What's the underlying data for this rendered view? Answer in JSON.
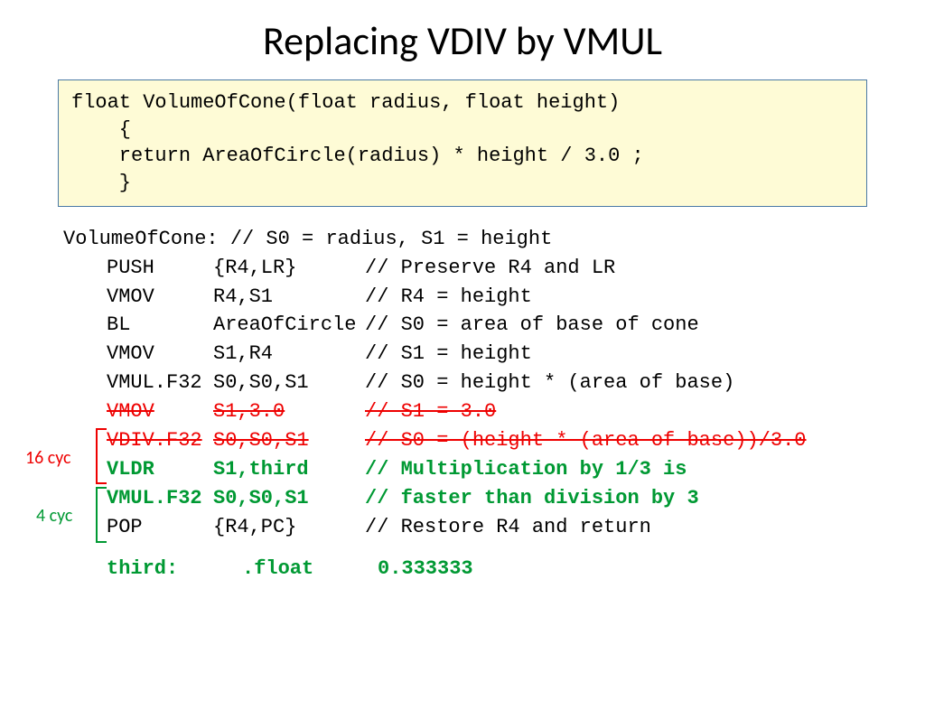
{
  "title": "Replacing VDIV by VMUL",
  "code": {
    "l1": "float VolumeOfCone(float radius, float height)",
    "l2": "    {",
    "l3": "    return AreaOfCircle(radius) * height / 3.0 ;",
    "l4": "    }"
  },
  "asm": {
    "hdr": "VolumeOfCone: // S0 = radius, S1 = height",
    "r1": {
      "mn": "PUSH",
      "arg": "{R4,LR}",
      "cmt": "// Preserve R4 and LR"
    },
    "r2": {
      "mn": "VMOV",
      "arg": "R4,S1",
      "cmt": "// R4 = height"
    },
    "r3": {
      "mn": "BL",
      "arg": "AreaOfCircle",
      "cmt": "// S0 = area of base of cone"
    },
    "r4": {
      "mn": "VMOV",
      "arg": "S1,R4",
      "cmt": "// S1 = height"
    },
    "r5": {
      "mn": "VMUL.F32",
      "arg": "S0,S0,S1",
      "cmt": "// S0 = height * (area of base)"
    },
    "r6": {
      "mn": "VMOV",
      "arg": "S1,3.0",
      "cmt": "// S1 = 3.0"
    },
    "r7": {
      "mn": "VDIV.F32",
      "arg": "S0,S0,S1",
      "cmt": "// S0 = (height * (area of base))/3.0"
    },
    "r8": {
      "mn": "VLDR",
      "arg": "S1,third",
      "cmt": "// Multiplication by 1/3 is"
    },
    "r9": {
      "mn": "VMUL.F32",
      "arg": "S0,S0,S1",
      "cmt": "// faster than division by 3"
    },
    "r10": {
      "mn": "POP",
      "arg": "{R4,PC}",
      "cmt": "// Restore R4 and return"
    },
    "third": {
      "lbl": "third:",
      "dir": ".float",
      "val": "0.333333"
    }
  },
  "annot": {
    "cyc16": "16 cyc",
    "cyc4": "4 cyc"
  }
}
